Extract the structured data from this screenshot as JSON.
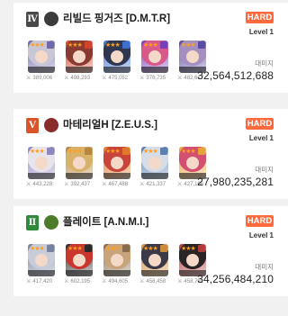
{
  "level_prefix": "Level",
  "damage_label": "대미지",
  "teams": [
    {
      "rank": "Ⅳ",
      "rank_color": "#4a4a4a",
      "emblem_color": "#3b3b3b",
      "emblem_icon": "gear-emblem-icon",
      "name": "리빌드 핑거즈 [D.M.T.R]",
      "difficulty": "HARD",
      "level": "Level 1",
      "damage": "32,564,512,688",
      "units": [
        {
          "power": "389,006",
          "hair": "#c9c6d6",
          "accent": "#6f6aa8"
        },
        {
          "power": "498,293",
          "hair": "#8a3b2f",
          "accent": "#d2452c"
        },
        {
          "power": "475,052",
          "hair": "#2f3650",
          "accent": "#3d6fd1"
        },
        {
          "power": "376,735",
          "hair": "#d85a8a",
          "accent": "#7a3cb8"
        },
        {
          "power": "482,617",
          "hair": "#a48fc0",
          "accent": "#5a4aa2"
        }
      ]
    },
    {
      "rank": "Ⅴ",
      "rank_color": "#d9542b",
      "emblem_color": "#8b2c2c",
      "emblem_icon": "star-emblem-icon",
      "name": "마테리얼H [Z.E.U.S.]",
      "difficulty": "HARD",
      "level": "Level 1",
      "damage": "27,980,235,281",
      "units": [
        {
          "power": "443,228",
          "hair": "#e7e4ec",
          "accent": "#8f86c0"
        },
        {
          "power": "392,437",
          "hair": "#d8b26a",
          "accent": "#b8863c"
        },
        {
          "power": "467,488",
          "hair": "#c9453a",
          "accent": "#e07a2a"
        },
        {
          "power": "421,337",
          "hair": "#d6dde6",
          "accent": "#5d7fb0"
        },
        {
          "power": "427,166",
          "hair": "#d45070",
          "accent": "#e9a13a"
        }
      ]
    },
    {
      "rank": "Ⅱ",
      "rank_color": "#2f8a3a",
      "emblem_color": "#4c7c2a",
      "emblem_icon": "cross-emblem-icon",
      "name": "플레이트 [A.N.M.I.]",
      "difficulty": "HARD",
      "level": "Level 1",
      "damage": "34,256,484,210",
      "units": [
        {
          "power": "417,420",
          "hair": "#c8ccd8",
          "accent": "#77829e"
        },
        {
          "power": "602,195",
          "hair": "#c9362e",
          "accent": "#2b2b2b"
        },
        {
          "power": "494,605",
          "hair": "#c9a47a",
          "accent": "#8a6b4a"
        },
        {
          "power": "458,458",
          "hair": "#3c3a46",
          "accent": "#cf8b3a"
        },
        {
          "power": "458,791",
          "hair": "#2b2427",
          "accent": "#b33a3a"
        }
      ]
    }
  ]
}
